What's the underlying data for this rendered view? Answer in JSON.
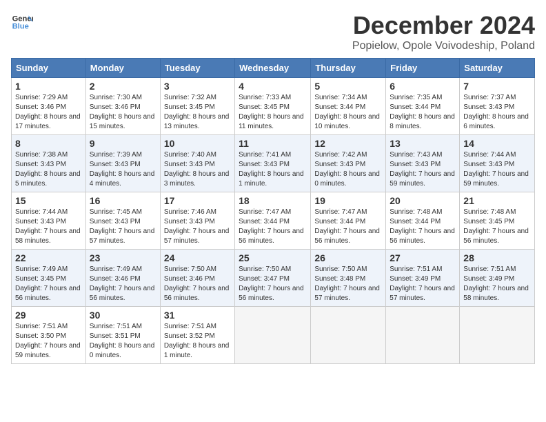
{
  "header": {
    "logo_line1": "General",
    "logo_line2": "Blue",
    "month": "December 2024",
    "location": "Popielow, Opole Voivodeship, Poland"
  },
  "weekdays": [
    "Sunday",
    "Monday",
    "Tuesday",
    "Wednesday",
    "Thursday",
    "Friday",
    "Saturday"
  ],
  "weeks": [
    [
      {
        "day": 1,
        "sunrise": "7:29 AM",
        "sunset": "3:46 PM",
        "daylight": "8 hours and 17 minutes."
      },
      {
        "day": 2,
        "sunrise": "7:30 AM",
        "sunset": "3:46 PM",
        "daylight": "8 hours and 15 minutes."
      },
      {
        "day": 3,
        "sunrise": "7:32 AM",
        "sunset": "3:45 PM",
        "daylight": "8 hours and 13 minutes."
      },
      {
        "day": 4,
        "sunrise": "7:33 AM",
        "sunset": "3:45 PM",
        "daylight": "8 hours and 11 minutes."
      },
      {
        "day": 5,
        "sunrise": "7:34 AM",
        "sunset": "3:44 PM",
        "daylight": "8 hours and 10 minutes."
      },
      {
        "day": 6,
        "sunrise": "7:35 AM",
        "sunset": "3:44 PM",
        "daylight": "8 hours and 8 minutes."
      },
      {
        "day": 7,
        "sunrise": "7:37 AM",
        "sunset": "3:43 PM",
        "daylight": "8 hours and 6 minutes."
      }
    ],
    [
      {
        "day": 8,
        "sunrise": "7:38 AM",
        "sunset": "3:43 PM",
        "daylight": "8 hours and 5 minutes."
      },
      {
        "day": 9,
        "sunrise": "7:39 AM",
        "sunset": "3:43 PM",
        "daylight": "8 hours and 4 minutes."
      },
      {
        "day": 10,
        "sunrise": "7:40 AM",
        "sunset": "3:43 PM",
        "daylight": "8 hours and 3 minutes."
      },
      {
        "day": 11,
        "sunrise": "7:41 AM",
        "sunset": "3:43 PM",
        "daylight": "8 hours and 1 minute."
      },
      {
        "day": 12,
        "sunrise": "7:42 AM",
        "sunset": "3:43 PM",
        "daylight": "8 hours and 0 minutes."
      },
      {
        "day": 13,
        "sunrise": "7:43 AM",
        "sunset": "3:43 PM",
        "daylight": "7 hours and 59 minutes."
      },
      {
        "day": 14,
        "sunrise": "7:44 AM",
        "sunset": "3:43 PM",
        "daylight": "7 hours and 59 minutes."
      }
    ],
    [
      {
        "day": 15,
        "sunrise": "7:44 AM",
        "sunset": "3:43 PM",
        "daylight": "7 hours and 58 minutes."
      },
      {
        "day": 16,
        "sunrise": "7:45 AM",
        "sunset": "3:43 PM",
        "daylight": "7 hours and 57 minutes."
      },
      {
        "day": 17,
        "sunrise": "7:46 AM",
        "sunset": "3:43 PM",
        "daylight": "7 hours and 57 minutes."
      },
      {
        "day": 18,
        "sunrise": "7:47 AM",
        "sunset": "3:44 PM",
        "daylight": "7 hours and 56 minutes."
      },
      {
        "day": 19,
        "sunrise": "7:47 AM",
        "sunset": "3:44 PM",
        "daylight": "7 hours and 56 minutes."
      },
      {
        "day": 20,
        "sunrise": "7:48 AM",
        "sunset": "3:44 PM",
        "daylight": "7 hours and 56 minutes."
      },
      {
        "day": 21,
        "sunrise": "7:48 AM",
        "sunset": "3:45 PM",
        "daylight": "7 hours and 56 minutes."
      }
    ],
    [
      {
        "day": 22,
        "sunrise": "7:49 AM",
        "sunset": "3:45 PM",
        "daylight": "7 hours and 56 minutes."
      },
      {
        "day": 23,
        "sunrise": "7:49 AM",
        "sunset": "3:46 PM",
        "daylight": "7 hours and 56 minutes."
      },
      {
        "day": 24,
        "sunrise": "7:50 AM",
        "sunset": "3:46 PM",
        "daylight": "7 hours and 56 minutes."
      },
      {
        "day": 25,
        "sunrise": "7:50 AM",
        "sunset": "3:47 PM",
        "daylight": "7 hours and 56 minutes."
      },
      {
        "day": 26,
        "sunrise": "7:50 AM",
        "sunset": "3:48 PM",
        "daylight": "7 hours and 57 minutes."
      },
      {
        "day": 27,
        "sunrise": "7:51 AM",
        "sunset": "3:49 PM",
        "daylight": "7 hours and 57 minutes."
      },
      {
        "day": 28,
        "sunrise": "7:51 AM",
        "sunset": "3:49 PM",
        "daylight": "7 hours and 58 minutes."
      }
    ],
    [
      {
        "day": 29,
        "sunrise": "7:51 AM",
        "sunset": "3:50 PM",
        "daylight": "7 hours and 59 minutes."
      },
      {
        "day": 30,
        "sunrise": "7:51 AM",
        "sunset": "3:51 PM",
        "daylight": "8 hours and 0 minutes."
      },
      {
        "day": 31,
        "sunrise": "7:51 AM",
        "sunset": "3:52 PM",
        "daylight": "8 hours and 1 minute."
      },
      null,
      null,
      null,
      null
    ]
  ]
}
